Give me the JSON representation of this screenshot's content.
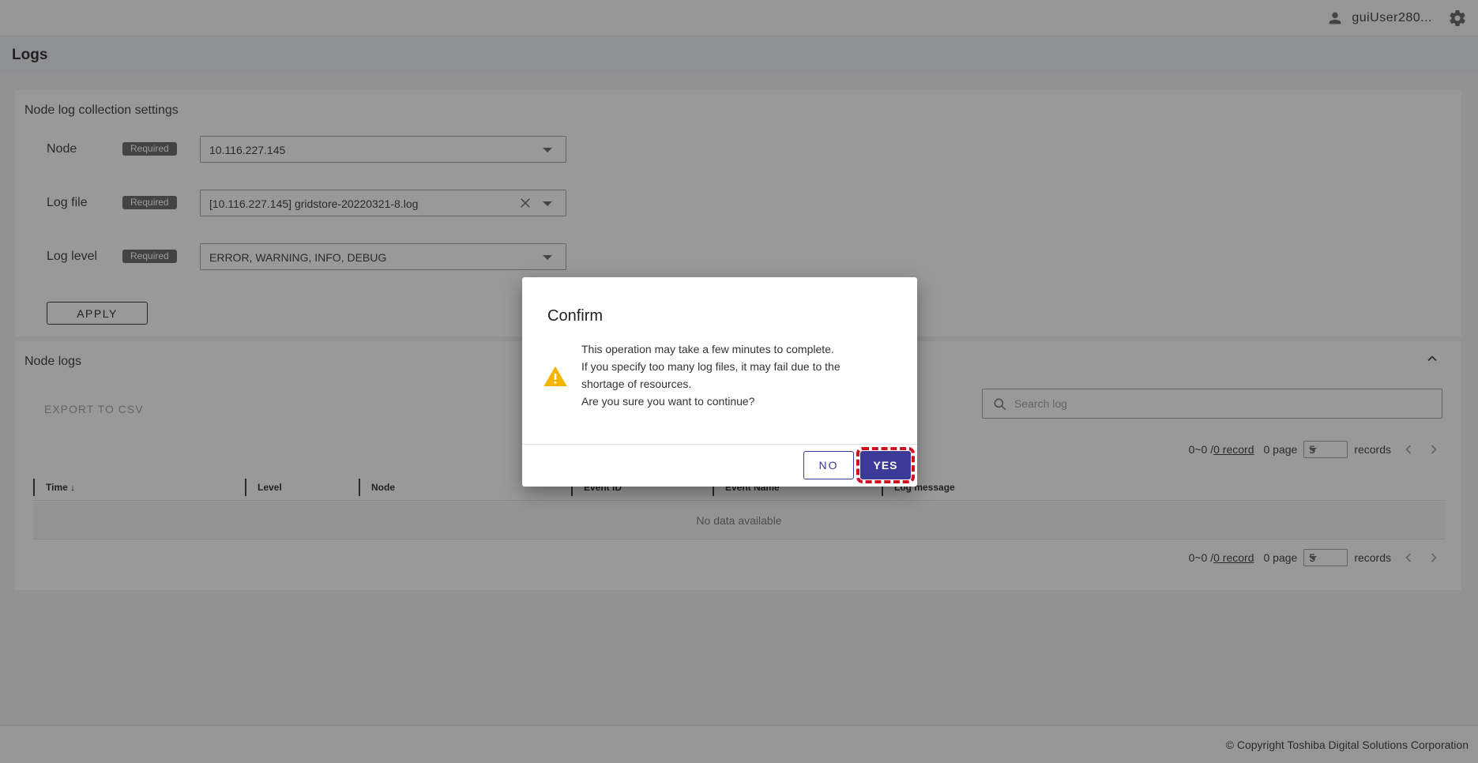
{
  "header": {
    "username": "guiUser280..."
  },
  "page": {
    "title": "Logs"
  },
  "settings": {
    "title": "Node log collection settings",
    "required_label": "Required",
    "node": {
      "label": "Node",
      "value": "10.116.227.145"
    },
    "log_file": {
      "label": "Log file",
      "value": "[10.116.227.145] gridstore-20220321-8.log"
    },
    "log_level": {
      "label": "Log level",
      "value": "ERROR, WARNING, INFO, DEBUG"
    },
    "apply_label": "APPLY"
  },
  "logs": {
    "title": "Node logs",
    "export_label": "EXPORT TO CSV",
    "search_placeholder": "Search log",
    "pagination": {
      "range": "0~0 / ",
      "record_link": "0 record",
      "page": "0 page",
      "page_size": "5",
      "records_label": "records"
    },
    "columns": [
      "Time",
      "Level",
      "Node",
      "Event ID",
      "Event Name",
      "Log message"
    ],
    "empty_text": "No data available"
  },
  "footer": {
    "copyright": "© Copyright Toshiba Digital Solutions Corporation"
  },
  "dialog": {
    "title": "Confirm",
    "lines": [
      "This operation may take a few minutes to complete.",
      "If you specify too many log files, it may fail due to the",
      "shortage of resources.",
      "Are you sure you want to continue?"
    ],
    "no_label": "NO",
    "yes_label": "YES"
  },
  "colors": {
    "primary": "#3b3a96",
    "warning": "#f4b400",
    "highlight": "#d01020"
  }
}
